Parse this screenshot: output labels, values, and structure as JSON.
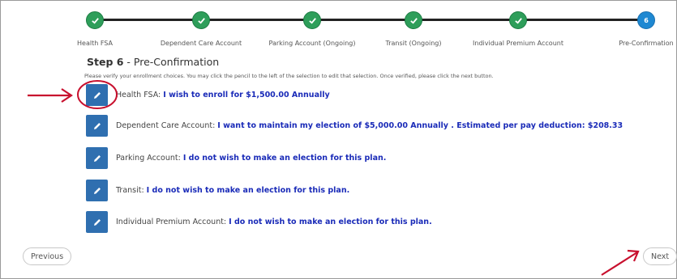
{
  "steps": [
    {
      "label": "Health FSA",
      "state": "complete"
    },
    {
      "label": "Dependent Care Account",
      "state": "complete"
    },
    {
      "label": "Parking Account (Ongoing)",
      "state": "complete"
    },
    {
      "label": "Transit (Ongoing)",
      "state": "complete"
    },
    {
      "label": "Individual Premium Account",
      "state": "complete"
    },
    {
      "label": "Pre-Confirmation",
      "state": "current",
      "number": "6"
    }
  ],
  "header": {
    "step_prefix": "Step 6",
    "step_suffix": " - Pre-Confirmation",
    "instructions": "Please verify your enrollment choices. You may click the pencil to the left of the selection to edit that selection. Once verified, please click the next button."
  },
  "selections": [
    {
      "label": "Health FSA:",
      "value": "I wish to enroll for $1,500.00 Annually"
    },
    {
      "label": "Dependent Care Account:",
      "value": "I want to maintain my election of $5,000.00 Annually . Estimated per pay deduction: $208.33"
    },
    {
      "label": "Parking Account:",
      "value": "I do not wish to make an election for this plan."
    },
    {
      "label": "Transit:",
      "value": "I do not wish to make an election for this plan."
    },
    {
      "label": "Individual Premium Account:",
      "value": "I do not wish to make an election for this plan."
    }
  ],
  "nav": {
    "previous": "Previous",
    "next": "Next"
  },
  "colors": {
    "complete": "#2e9e5a",
    "current": "#1e88d2",
    "edit_button": "#2f6fb0",
    "value_text": "#1a2bb8",
    "annotation": "#c8102e"
  },
  "icons": {
    "complete_step": "check-icon",
    "edit": "pencil-icon"
  }
}
